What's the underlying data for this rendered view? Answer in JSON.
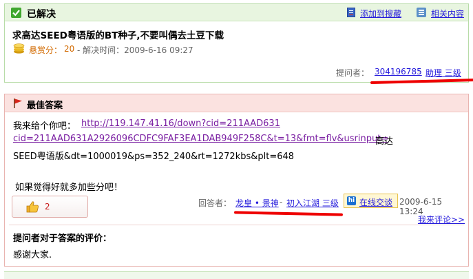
{
  "solved": {
    "header_title": "已解决",
    "add_favorite": "添加到搜藏",
    "related": "相关内容",
    "question_title": "求高达SEED粤语版的BT种子,不要叫偶去土豆下载",
    "bounty_label": "悬赏分：",
    "bounty_value": "20",
    "solve_time": "- 解决时间：2009-6-16 09:27",
    "asker_label": "提问者：",
    "asker_id": "304196785",
    "asker_sep": "-",
    "asker_level": "助理 三级"
  },
  "best_answer": {
    "header_title": "最佳答案",
    "intro": "我来给个你吧：",
    "link_part1": "http://119.147.41.16/down?cid=211AAD631",
    "link_part2": "cid=211AAD631A2926096CDFC9FAF3EA1DAB949F258C&t=13&fmt=flv&usrinput=",
    "line2_tail": "高达",
    "line3": "SEED粤语版&dt=1000019&ps=352_240&rt=1272kbs&plt=648",
    "line4": "如果觉得好就多加些分吧！",
    "like_count": "2",
    "answerer_label": "回答者：",
    "answerer_name": "龙皇 • 景神",
    "answerer_sep": "-",
    "answerer_level": "初入江湖 三级",
    "chat_icon_text": "hi",
    "chat_label": "在线交谈",
    "answer_time": "2009-6-15 13:24",
    "comment_link": "我来评论>>",
    "eval_title": "提问者对于答案的评价：",
    "eval_text": "感谢大家."
  },
  "colors": {
    "solved_bg": "#e8f5e0",
    "best_bg": "#fbe2e0",
    "link": "#261cdc",
    "visited_link": "#7a1fa2",
    "bounty": "#d26a00",
    "annotation_mark": "#ee0000"
  },
  "icons": [
    "check-icon",
    "bookmark-icon",
    "related-icon",
    "coin-icon",
    "flag-icon",
    "thumbs-up-icon",
    "hi-icon"
  ]
}
